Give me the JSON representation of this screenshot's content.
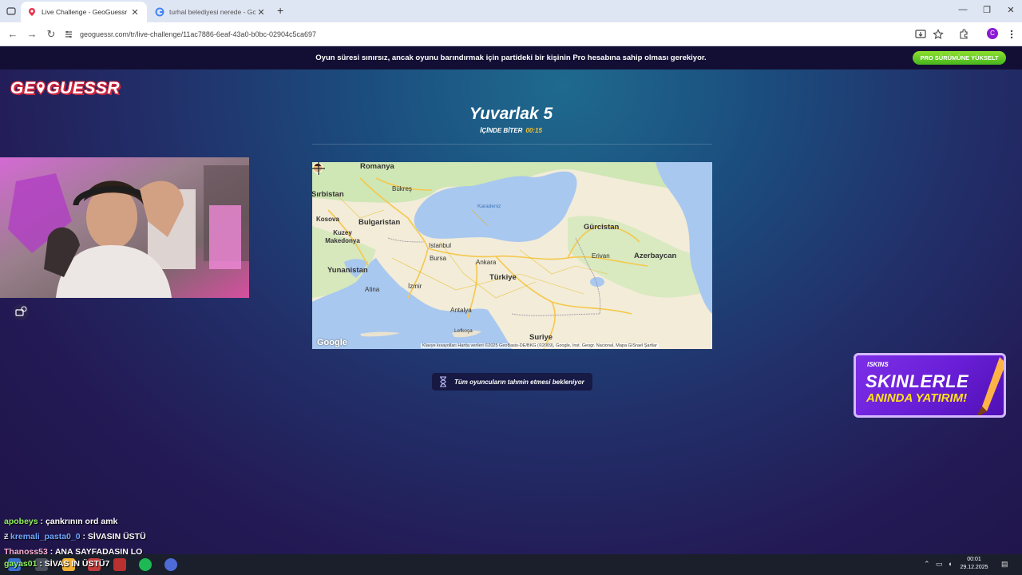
{
  "browser": {
    "tabs": [
      {
        "title": "Live Challenge - GeoGuessr",
        "active": true
      },
      {
        "title": "turhal belediyesi nerede - Goog",
        "active": false
      }
    ],
    "close_glyph": "✕",
    "new_tab_glyph": "+",
    "url": "geoguessr.com/tr/live-challenge/11ac7886-6eaf-43a0-b0bc-02904c5ca697",
    "profile_initial": "C"
  },
  "banner": {
    "text": "Oyun süresi sınırsız, ancak oyunu barındırmak için partideki bir kişinin Pro hesabına sahip olması gerekiyor.",
    "button": "PRO SÜRÜMÜNE YÜKSELT"
  },
  "logo": {
    "text_before": "GE",
    "text_after": "GUESSR"
  },
  "round": {
    "title": "Yuvarlak 5",
    "timer_label": "İÇİNDE BİTER",
    "timer_value": "00:15"
  },
  "map": {
    "countries": [
      "Romanya",
      "Sırbistan",
      "Bulgaristan",
      "Kosova",
      "Kuzey Makedonya",
      "Yunanistan",
      "Türkiye",
      "Gürcistan",
      "Azerbaycan",
      "Suriye"
    ],
    "cities": [
      "Bükreş",
      "Istanbul",
      "Bursa",
      "Ankara",
      "İzmir",
      "Antalya",
      "Erivan",
      "Atina",
      "Lefkoşa"
    ],
    "sea": "Karadeniz",
    "attribution": "Klavye kısayolları    Harita verileri ©2025 GeoBasis-DE/BKG (©2009), Google, Inst. Geogr. Nacional, Mapa GISrael    Şartlar",
    "provider": "Google"
  },
  "waiting": {
    "text": "Tüm oyuncuların tahmin etmesi bekleniyor"
  },
  "ad": {
    "brand": "ISKINS",
    "line1": "SKINLERLE",
    "line2": "ANINDA YATIRIM!"
  },
  "chat": [
    {
      "user": "apobeys",
      "message": "çankrının ord amk",
      "color": "#8ef05a"
    },
    {
      "user": "kremali_pasta0_0",
      "message": "SİVASIN ÜSTÜ",
      "color": "#6ea8ff"
    },
    {
      "user": "Thanoss53",
      "message": "ANA SAYFADASIN LO",
      "color": "#ffb3d1"
    },
    {
      "user": "gayas01",
      "message": "SİVAS IN ÜSTÜ7",
      "color": "#8ef05a"
    }
  ],
  "taskbar": {
    "time": "00:01",
    "date": "29.12.2025"
  },
  "colors": {
    "accent_green": "#5cc524",
    "timer_yellow": "#f8c537",
    "brand_red": "#e7334c"
  }
}
